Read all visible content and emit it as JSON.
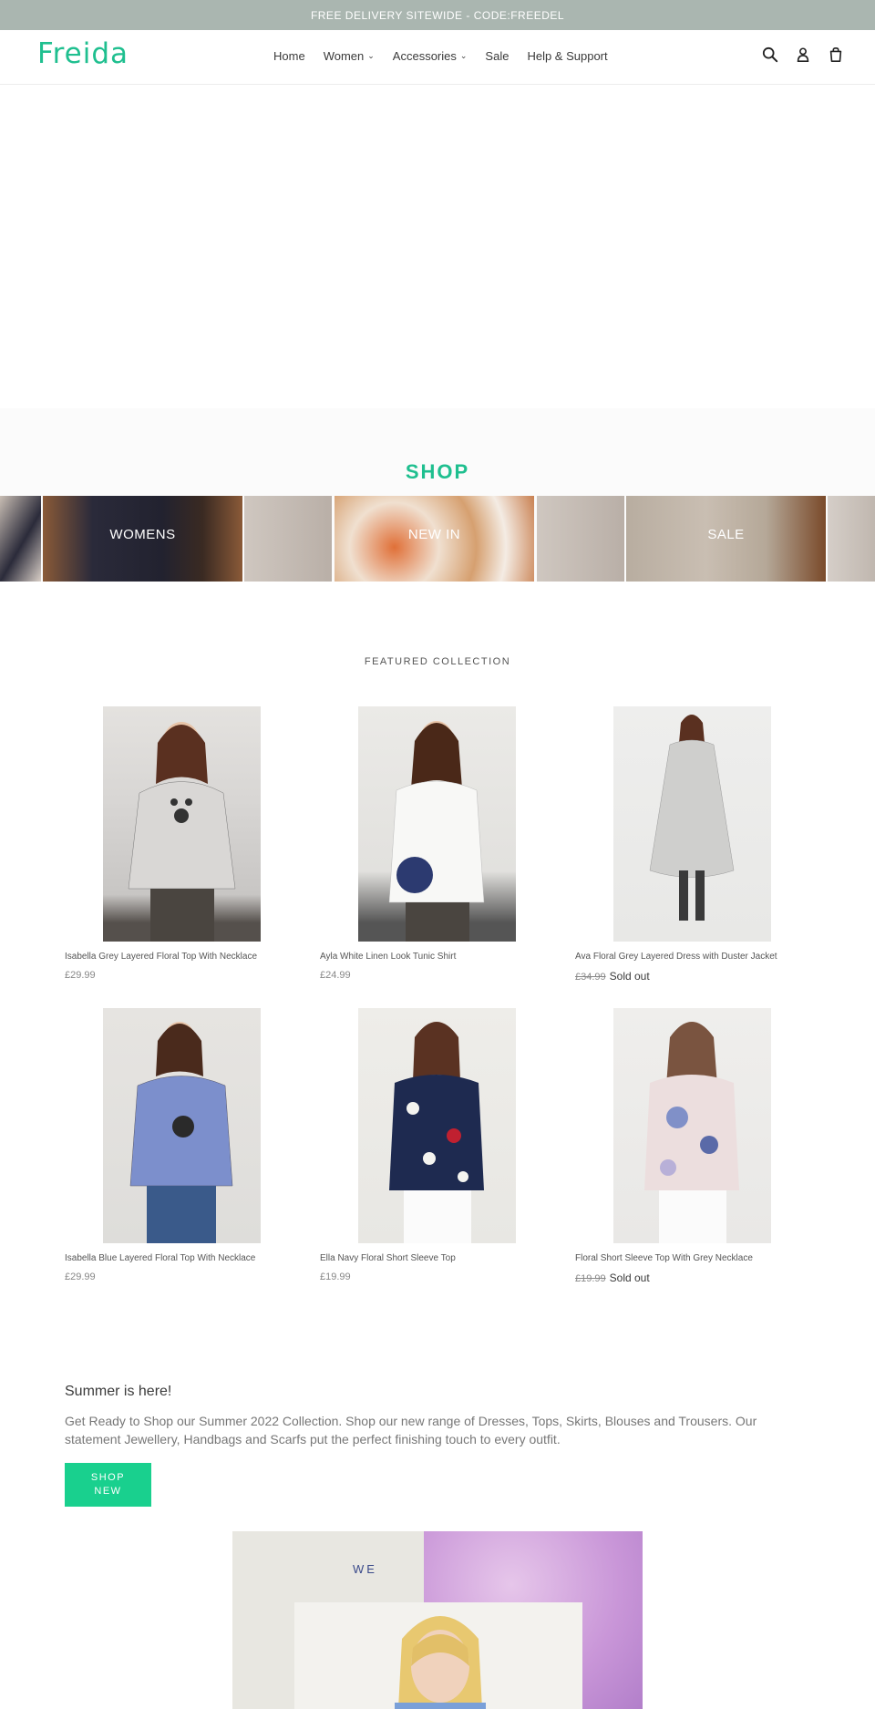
{
  "announcement": "FREE DELIVERY SITEWIDE - CODE:FREEDEL",
  "brand": {
    "logo": "Freida",
    "color": "#1fbf8f"
  },
  "nav": {
    "items": [
      {
        "label": "Home",
        "dropdown": false
      },
      {
        "label": "Women",
        "dropdown": true
      },
      {
        "label": "Accessories",
        "dropdown": true
      },
      {
        "label": "Sale",
        "dropdown": false
      },
      {
        "label": "Help & Support",
        "dropdown": false
      }
    ]
  },
  "header_icons": [
    "search-icon",
    "account-icon",
    "cart-icon"
  ],
  "shop": {
    "title": "SHOP",
    "tiles": [
      {
        "label": "WOMENS"
      },
      {
        "label": "NEW IN"
      },
      {
        "label": "SALE"
      }
    ]
  },
  "featured": {
    "title": "FEATURED COLLECTION",
    "products": [
      {
        "name": "Isabella Grey Layered Floral Top With Necklace",
        "price": "£29.99",
        "compare": "",
        "sold_out": ""
      },
      {
        "name": "Ayla White Linen Look Tunic Shirt",
        "price": "£24.99",
        "compare": "",
        "sold_out": ""
      },
      {
        "name": "Ava Floral Grey Layered Dress with Duster Jacket",
        "price": "",
        "compare": "£34.99",
        "sold_out": "Sold out"
      },
      {
        "name": "Isabella Blue Layered Floral Top With Necklace",
        "price": "£29.99",
        "compare": "",
        "sold_out": ""
      },
      {
        "name": "Ella Navy Floral Short Sleeve Top",
        "price": "£19.99",
        "compare": "",
        "sold_out": ""
      },
      {
        "name": "Floral Short Sleeve Top With Grey Necklace",
        "price": "",
        "compare": "£19.99",
        "sold_out": "Sold out"
      }
    ]
  },
  "summer": {
    "heading": "Summer is here!",
    "text": "Get Ready to Shop our Summer 2022 Collection. Shop our new range of Dresses, Tops, Skirts, Blouses and Trousers. Our statement Jewellery, Handbags and Scarfs put the perfect finishing touch to every outfit.",
    "button_line1": "SHOP",
    "button_line2": "NEW"
  },
  "promo": {
    "text": "WE"
  }
}
